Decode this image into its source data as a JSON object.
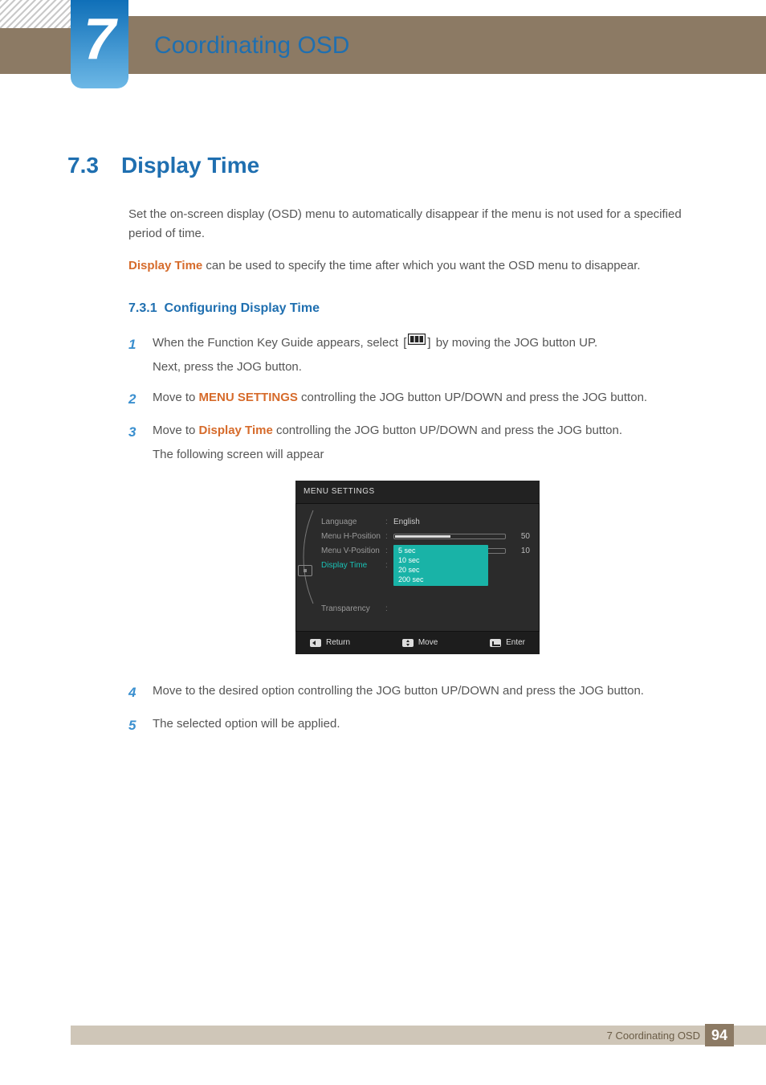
{
  "chapter": {
    "number": "7",
    "title": "Coordinating OSD"
  },
  "section": {
    "number": "7.3",
    "title": "Display Time"
  },
  "intro": {
    "p1": "Set the on-screen display (OSD) menu to automatically disappear if the menu is not used for a specified period of time.",
    "term": "Display Time",
    "p2_rest": " can be used to specify the time after which you want the OSD menu to disappear."
  },
  "subsection": {
    "number": "7.3.1",
    "title": "Configuring Display Time"
  },
  "steps": {
    "s1a": "When the Function Key Guide appears, select ",
    "s1b": " by moving the JOG button UP.",
    "s1c": "Next, press the JOG button.",
    "s2a": "Move to ",
    "s2_term": "MENU SETTINGS",
    "s2b": " controlling the JOG button UP/DOWN and press the JOG button.",
    "s3a": "Move to ",
    "s3_term": "Display Time",
    "s3b": " controlling the JOG button UP/DOWN and press the JOG button.",
    "s3c": "The following screen will appear",
    "s4": "Move to the desired option controlling the JOG button UP/DOWN and press the JOG button.",
    "s5": "The selected option will be applied."
  },
  "osd": {
    "title": "MENU SETTINGS",
    "rows": {
      "language": {
        "label": "Language",
        "value": "English"
      },
      "hpos": {
        "label": "Menu H-Position",
        "value": "50",
        "fill": "50%"
      },
      "vpos": {
        "label": "Menu V-Position",
        "value": "10",
        "fill": "10%"
      },
      "display_time": {
        "label": "Display Time"
      },
      "transparency": {
        "label": "Transparency"
      }
    },
    "options": [
      "5 sec",
      "10 sec",
      "20 sec",
      "200 sec"
    ],
    "footer": {
      "return": "Return",
      "move": "Move",
      "enter": "Enter"
    }
  },
  "footer": {
    "text": "7 Coordinating OSD",
    "page": "94"
  }
}
